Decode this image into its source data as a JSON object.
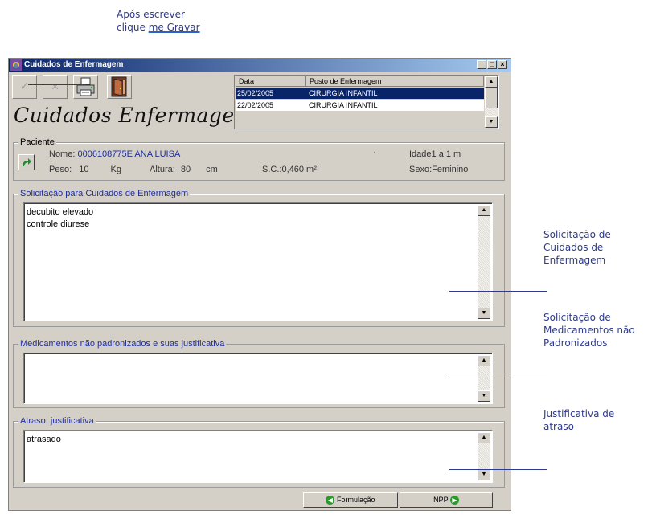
{
  "annotations": {
    "top_line1": "Após escrever",
    "top_line2_prefix": "clique ",
    "top_line2_link": "me Gravar",
    "right1": [
      "Solicitação de",
      "Cuidados de",
      "Enfermagem"
    ],
    "right2": [
      "Solicitação de",
      "Medicamentos não",
      "Padronizados"
    ],
    "right3": [
      "Justificativa de",
      "atraso"
    ]
  },
  "window": {
    "title": "Cuidados de Enfermagem",
    "min_symbol": "_",
    "max_symbol": "□",
    "close_symbol": "×",
    "big_title": "Cuidados Enfermagem"
  },
  "toolbar": {
    "icons": [
      "check-icon",
      "cancel-icon",
      "printer-icon",
      "exit-door-icon"
    ],
    "check_glyph": "✓",
    "cancel_glyph": "✕"
  },
  "history": {
    "columns": [
      "Data",
      "Posto de Enfermagem"
    ],
    "rows": [
      {
        "date": "25/02/2005",
        "post": "CIRURGIA INFANTIL",
        "selected": true
      },
      {
        "date": "22/02/2005",
        "post": "CIRURGIA INFANTIL",
        "selected": false
      }
    ]
  },
  "patient": {
    "legend": "Paciente",
    "name_label": "Nome:",
    "name_value": "0006108775E  ANA LUISA",
    "dot": "·",
    "age_label": "Idade",
    "age_value": "1 a 1 m",
    "weight_label": "Peso:",
    "weight_value": "10",
    "weight_unit": "Kg",
    "height_label": "Altura:",
    "height_value": "80",
    "height_unit": "cm",
    "sc_label": "S.C.:",
    "sc_value": "0,460 m²",
    "sex_label": "Sexo:",
    "sex_value": "Feminino"
  },
  "sections": {
    "care_legend": "Solicitação para Cuidados de Enfermagem",
    "care_text_1": "decubito elevado",
    "care_text_2": "controle diurese",
    "meds_legend": "Medicamentos não padronizados e suas justificativa",
    "meds_text": "",
    "delay_legend": "Atraso: justificativa",
    "delay_text": "atrasado"
  },
  "buttons": {
    "formulacao": "Formulação",
    "npp": "NPP"
  },
  "colors": {
    "accent": "#2e3a8c",
    "selection": "#0a246a"
  }
}
